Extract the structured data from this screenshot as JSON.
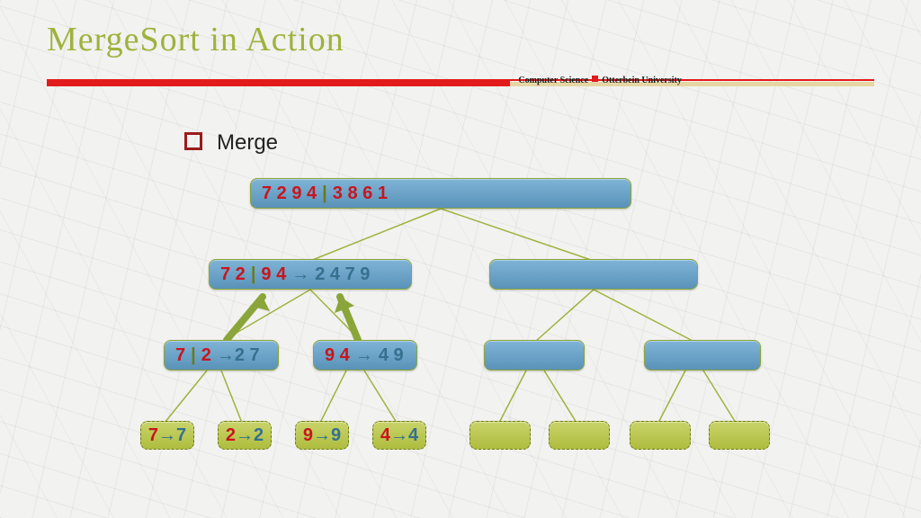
{
  "title": "MergeSort in Action",
  "header": {
    "dept": "Computer Science",
    "inst": "Otterbein University"
  },
  "bullet": "Merge",
  "colors": {
    "txtRed": "#c8151d",
    "txtTeal": "#35708e",
    "txtOlive": "#6a7a1f",
    "line": "#9fb23d"
  },
  "nodes": {
    "root": {
      "left": "7 2 9 4",
      "pipe": "|",
      "right": "3 8 6 1"
    },
    "l1L": {
      "a": "7 2",
      "pipe": "|",
      "b": "9 4",
      "arrow": "→",
      "merged": "2 4 7 9"
    },
    "l2LL": {
      "a": "7",
      "pipe": "|",
      "b": "2",
      "arrow": "→",
      "merged": "2 7"
    },
    "l2LR": {
      "a": "9 4",
      "arrow": "→",
      "merged": "4 9"
    },
    "leaf1": {
      "in": "7",
      "arrow": "→",
      "out": "7"
    },
    "leaf2": {
      "in": "2",
      "arrow": "→",
      "out": "2"
    },
    "leaf3": {
      "in": "9",
      "arrow": "→",
      "out": "9"
    },
    "leaf4": {
      "in": "4",
      "arrow": "→",
      "out": "4"
    }
  },
  "chart_data": {
    "type": "tree",
    "title": "MergeSort in Action — Merge",
    "input": [
      7,
      2,
      9,
      4,
      3,
      8,
      6,
      1
    ],
    "root": {
      "left": [
        7,
        2,
        9,
        4
      ],
      "right": [
        3,
        8,
        6,
        1
      ]
    },
    "left_subtree": {
      "halves": {
        "left": [
          7,
          2
        ],
        "right": [
          9,
          4
        ]
      },
      "merged": [
        2,
        4,
        7,
        9
      ],
      "children": [
        {
          "halves": {
            "left": [
              7
            ],
            "right": [
              2
            ]
          },
          "merged": [
            2,
            7
          ]
        },
        {
          "input": [
            9,
            4
          ],
          "merged": [
            4,
            9
          ]
        }
      ],
      "leaves": [
        {
          "in": 7,
          "out": 7
        },
        {
          "in": 2,
          "out": 2
        },
        {
          "in": 9,
          "out": 9
        },
        {
          "in": 4,
          "out": 4
        }
      ]
    },
    "right_subtree": {
      "shown": false,
      "placeholder_nodes": {
        "level1": 1,
        "level2": 2,
        "leaves": 4
      }
    },
    "edges": [
      [
        "root",
        "l1L"
      ],
      [
        "root",
        "l1R"
      ],
      [
        "l1L",
        "l2LL"
      ],
      [
        "l1L",
        "l2LR"
      ],
      [
        "l1R",
        "l2RL"
      ],
      [
        "l1R",
        "l2RR"
      ],
      [
        "l2LL",
        "leaf1"
      ],
      [
        "l2LL",
        "leaf2"
      ],
      [
        "l2LR",
        "leaf3"
      ],
      [
        "l2LR",
        "leaf4"
      ],
      [
        "l2RL",
        "leaf5"
      ],
      [
        "l2RL",
        "leaf6"
      ],
      [
        "l2RR",
        "leaf7"
      ],
      [
        "l2RR",
        "leaf8"
      ]
    ],
    "highlight_arrows_up": [
      [
        "l2LL",
        "l1L"
      ],
      [
        "l2LR",
        "l1L"
      ]
    ]
  }
}
